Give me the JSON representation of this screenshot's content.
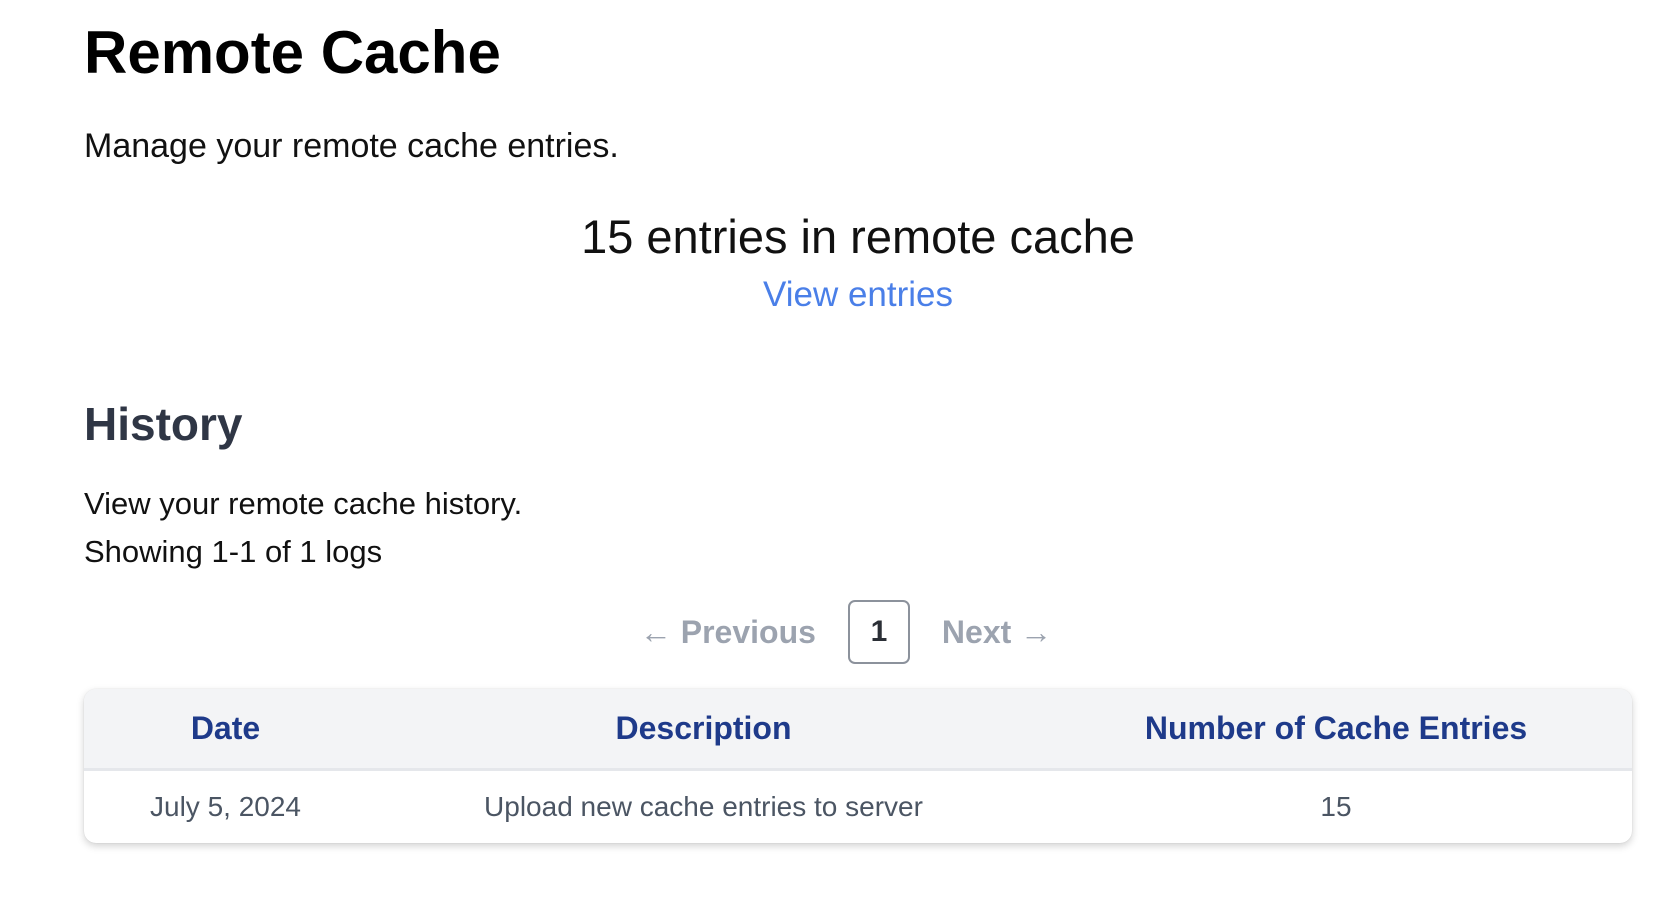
{
  "header": {
    "title": "Remote Cache",
    "subtitle": "Manage your remote cache entries."
  },
  "summary": {
    "count_text": "15 entries in remote cache",
    "view_link": "View entries"
  },
  "history": {
    "title": "History",
    "subtitle": "View your remote cache history.",
    "showing": "Showing 1-1 of 1 logs"
  },
  "pagination": {
    "previous": "← Previous",
    "current_page": "1",
    "next": "Next →"
  },
  "table": {
    "columns": [
      "Date",
      "Description",
      "Number of Cache Entries"
    ],
    "rows": [
      [
        "July 5, 2024",
        "Upload new cache entries to server",
        "15"
      ]
    ]
  },
  "colors": {
    "link": "#4a7fe8",
    "header_text": "#1e3a8a",
    "muted": "#9ca3af"
  }
}
